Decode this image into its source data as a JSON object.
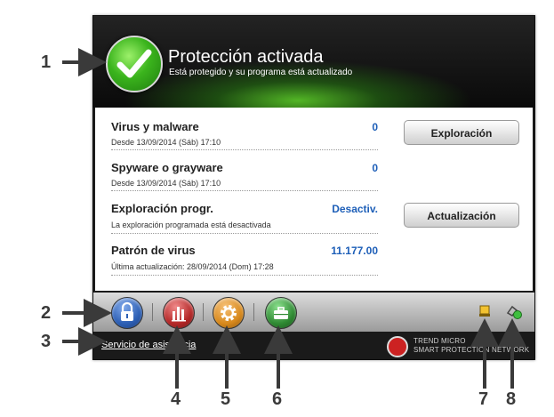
{
  "header": {
    "title": "Protección activada",
    "subtitle": "Está protegido y su programa está actualizado"
  },
  "status": {
    "virus": {
      "title": "Virus y malware",
      "value": "0",
      "sub": "Desde 13/09/2014 (Sáb) 17:10"
    },
    "spyware": {
      "title": "Spyware o grayware",
      "value": "0",
      "sub": "Desde 13/09/2014 (Sáb) 17:10"
    },
    "scheduled": {
      "title": "Exploración progr.",
      "value": "Desactiv.",
      "sub": "La exploración programada está desactivada"
    },
    "pattern": {
      "title": "Patrón de virus",
      "value": "11.177.00",
      "sub": "Última actualización: 28/09/2014 (Dom) 17:28"
    }
  },
  "buttons": {
    "scan": "Exploración",
    "update": "Actualización"
  },
  "footer": {
    "support": "Servicio de asistencia",
    "brand_line1": "TREND MICRO",
    "brand_line2": "SMART PROTECTION NETWORK"
  },
  "icons": {
    "lock": "lock-icon",
    "reports": "bar-chart-icon",
    "settings": "gear-icon",
    "tools": "toolbox-icon",
    "notice": "alert-icon",
    "network": "network-status-icon"
  },
  "colors": {
    "lock_button": "#2d5fb4",
    "reports_button": "#b42828",
    "settings_button": "#d8891c",
    "tools_button": "#2f8a33",
    "value_blue": "#1e5fb8"
  },
  "callouts": [
    "1",
    "2",
    "3",
    "4",
    "5",
    "6",
    "7",
    "8"
  ]
}
